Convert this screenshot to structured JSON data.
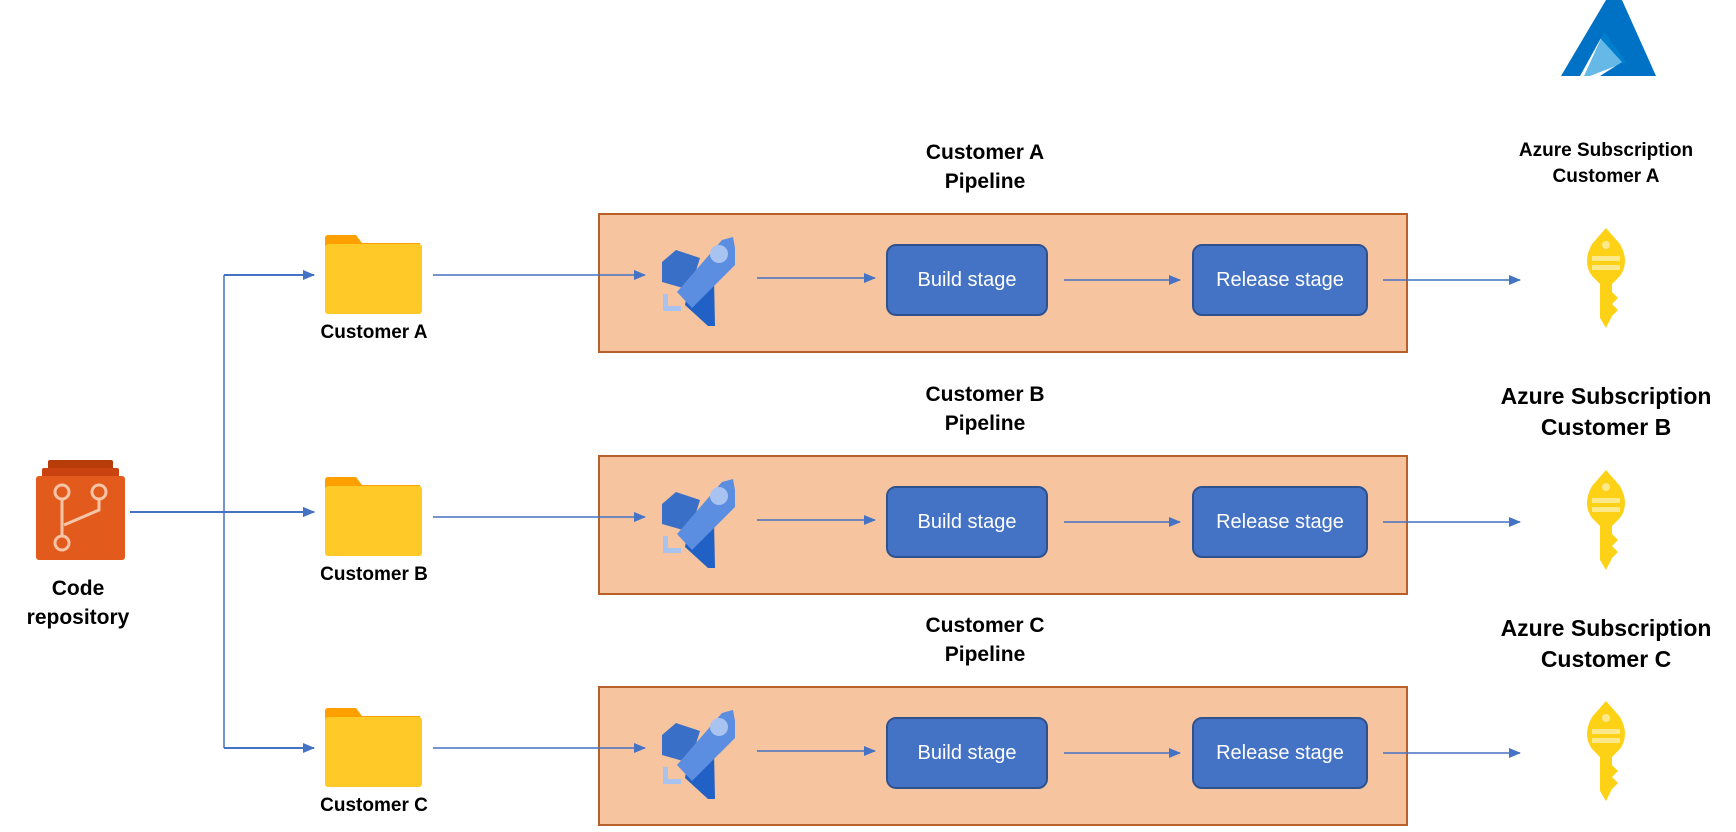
{
  "colors": {
    "connector": "#4472c4",
    "pipeline_fill": "#f7c4a0",
    "pipeline_border": "#b8602a",
    "stage_fill": "#4472c4",
    "folder": "#ffca28",
    "key": "#fcd116",
    "azure": "#0072c6",
    "repo": "#e25a1c"
  },
  "repository": {
    "label_line1": "Code",
    "label_line2": "repository",
    "icon": "git-repo-icon"
  },
  "logo": {
    "icon": "azure-logo-icon"
  },
  "rows": [
    {
      "folder_label": "Customer A",
      "pipeline_title_line1": "Customer A",
      "pipeline_title_line2": "Pipeline",
      "build_label": "Build stage",
      "release_label": "Release stage",
      "subscription_line1": "Azure Subscription",
      "subscription_line2": "Customer A"
    },
    {
      "folder_label": "Customer B",
      "pipeline_title_line1": "Customer B",
      "pipeline_title_line2": "Pipeline",
      "build_label": "Build stage",
      "release_label": "Release stage",
      "subscription_line1": "Azure Subscription",
      "subscription_line2": "Customer B"
    },
    {
      "folder_label": "Customer C",
      "pipeline_title_line1": "Customer C",
      "pipeline_title_line2": "Pipeline",
      "build_label": "Build stage",
      "release_label": "Release stage",
      "subscription_line1": "Azure Subscription",
      "subscription_line2": "Customer C"
    }
  ]
}
